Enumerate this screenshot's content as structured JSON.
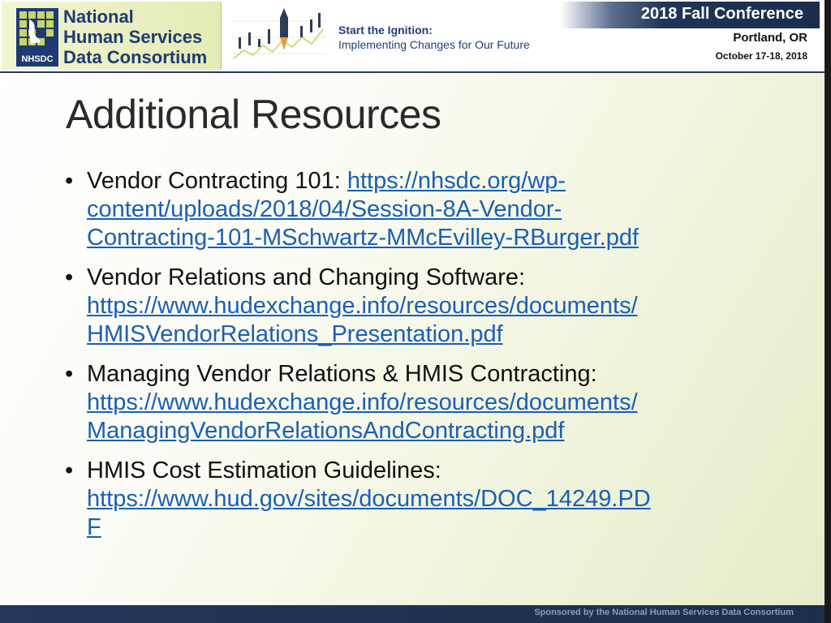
{
  "header": {
    "logo": {
      "lines": [
        "National",
        "Human Services",
        "Data Consortium"
      ],
      "mark_text": "NHSDC"
    },
    "tagline": {
      "line1": "Start the Ignition:",
      "line2": "Implementing Changes for Our Future"
    },
    "conference": {
      "title": "2018 Fall Conference",
      "city": "Portland, OR",
      "dates": "October 17-18, 2018"
    }
  },
  "slide": {
    "title": "Additional Resources",
    "bullets": [
      {
        "label": "Vendor Contracting 101: ",
        "link_lines": [
          "https://nhsdc.org/wp-",
          "content/uploads/2018/04/Session-8A-Vendor-",
          "Contracting-101-MSchwartz-MMcEvilley-RBurger.pdf"
        ]
      },
      {
        "label": "Vendor Relations and Changing Software:",
        "link_lines": [
          "https://www.hudexchange.info/resources/documents/",
          "HMISVendorRelations_Presentation.pdf"
        ]
      },
      {
        "label": "Managing Vendor Relations & HMIS Contracting:",
        "link_lines": [
          "https://www.hudexchange.info/resources/documents/",
          "ManagingVendorRelationsAndContracting.pdf"
        ]
      },
      {
        "label": "HMIS Cost Estimation Guidelines:",
        "link_lines": [
          "https://www.hud.gov/sites/documents/DOC_14249.PD",
          "F"
        ]
      }
    ]
  },
  "footer": {
    "text": "Sponsored by the National Human Services Data Consortium"
  },
  "colors": {
    "brand_navy": "#1e3a72",
    "link_blue": "#1a5fb4",
    "footer_navy": "#243759"
  }
}
